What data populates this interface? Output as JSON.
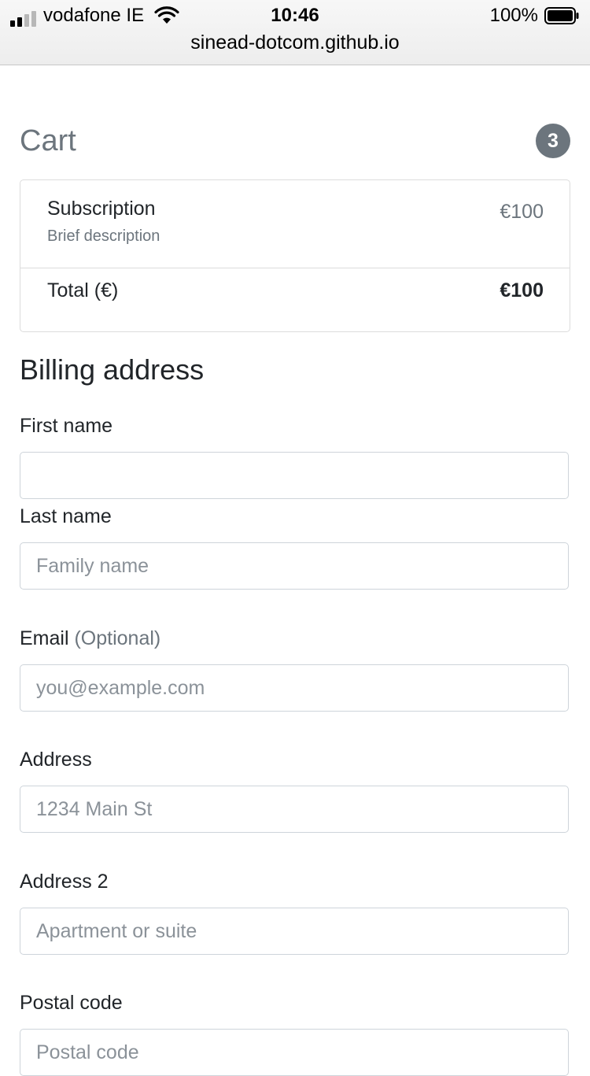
{
  "status_bar": {
    "carrier": "vodafone IE",
    "time": "10:46",
    "battery": "100%",
    "icons": [
      "signal-icon",
      "wifi-icon",
      "battery-icon"
    ]
  },
  "browser": {
    "url": "sinead-dotcom.github.io"
  },
  "cart": {
    "title": "Cart",
    "count": "3",
    "items": [
      {
        "name": "Subscription",
        "description": "Brief description",
        "price": "€100"
      }
    ],
    "total_label": "Total (€)",
    "total_value": "€100"
  },
  "billing": {
    "title": "Billing address",
    "first_name": {
      "label": "First name",
      "value": "",
      "placeholder": ""
    },
    "last_name": {
      "label": "Last name",
      "value": "",
      "placeholder": "Family name"
    },
    "email": {
      "label": "Email",
      "optional": "(Optional)",
      "value": "",
      "placeholder": "you@example.com"
    },
    "address": {
      "label": "Address",
      "value": "",
      "placeholder": "1234 Main St"
    },
    "address2": {
      "label": "Address 2",
      "value": "",
      "placeholder": "Apartment or suite"
    },
    "postal_code": {
      "label": "Postal code",
      "value": "",
      "placeholder": "Postal code"
    }
  },
  "colors": {
    "muted": "#6c757d",
    "text": "#212529",
    "border": "#ced4da"
  }
}
